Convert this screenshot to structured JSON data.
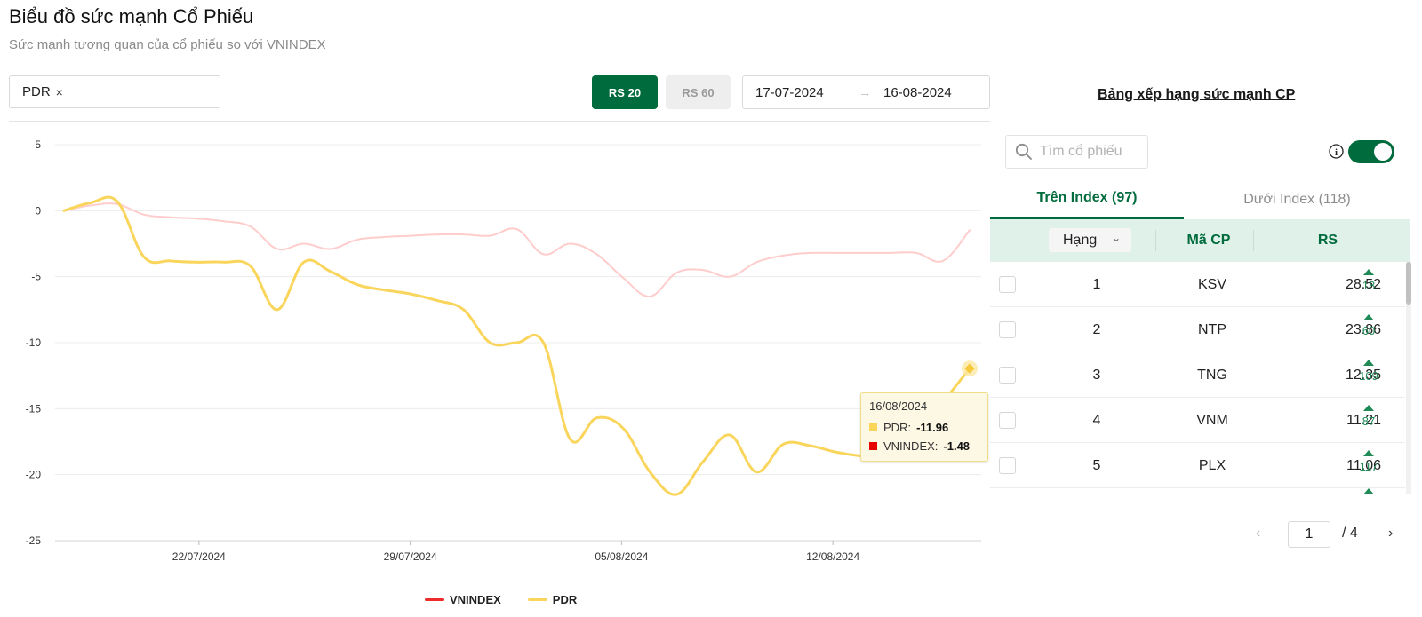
{
  "header": {
    "title": "Biểu đồ sức mạnh Cổ Phiếu",
    "subtitle": "Sức mạnh tương quan của cổ phiếu so với VNINDEX"
  },
  "filters": {
    "selected_stock": "PDR",
    "close_glyph": "×",
    "rs20_label": "RS 20",
    "rs60_label": "RS 60",
    "active_rs": "RS 20",
    "date_from": "17-07-2024",
    "date_arrow": "→",
    "date_to": "16-08-2024"
  },
  "chart_data": {
    "type": "line",
    "ylim": [
      -25,
      5
    ],
    "yticks": [
      "5",
      "0",
      "-5",
      "-10",
      "-15",
      "-20",
      "-25"
    ],
    "xticks": [
      "22/07/2024",
      "29/07/2024",
      "05/08/2024",
      "12/08/2024"
    ],
    "grid": true,
    "legend_position": "bottom",
    "series": [
      {
        "name": "VNINDEX",
        "color": "#ffcccc",
        "legend_color": "#ee2b2b",
        "values": [
          0,
          0.4,
          0.5,
          -0.3,
          -0.5,
          -0.6,
          -0.8,
          -1.2,
          -2.9,
          -2.5,
          -2.9,
          -2.2,
          -2.0,
          -1.9,
          -1.8,
          -1.8,
          -1.9,
          -1.4,
          -3.3,
          -2.5,
          -3.3,
          -5.1,
          -6.5,
          -4.7,
          -4.5,
          -5.0,
          -3.9,
          -3.4,
          -3.2,
          -3.2,
          -3.2,
          -3.2,
          -3.2,
          -3.8,
          -1.48
        ]
      },
      {
        "name": "PDR",
        "color": "#fad55c",
        "legend_color": "#fad55c",
        "values": [
          0,
          0.6,
          0.7,
          -3.5,
          -3.8,
          -3.9,
          -3.9,
          -4.2,
          -7.5,
          -3.9,
          -4.6,
          -5.6,
          -6.0,
          -6.3,
          -6.8,
          -7.5,
          -10.0,
          -10.0,
          -10.0,
          -17.3,
          -15.7,
          -16.5,
          -19.8,
          -21.5,
          -19.0,
          -17.0,
          -19.8,
          -17.7,
          -17.8,
          -18.3,
          -18.6,
          -18.7,
          -17.0,
          -14.5,
          -11.96
        ]
      }
    ],
    "tooltip": {
      "date": "16/08/2024",
      "rows": [
        {
          "name": "PDR:",
          "value": "-11.96",
          "color": "#fad55c"
        },
        {
          "name": "VNINDEX:",
          "value": "-1.48",
          "color": "#e60000"
        }
      ]
    }
  },
  "ranking": {
    "title": "Bảng xếp hạng sức mạnh CP",
    "search_placeholder": "Tìm cổ phiếu",
    "info_glyph": "i",
    "tabs": [
      {
        "label": "Trên Index (97)",
        "active": true
      },
      {
        "label": "Dưới Index (118)",
        "active": false
      }
    ],
    "columns": {
      "rank": "Hạng",
      "code": "Mã CP",
      "rs": "RS"
    },
    "sort_glyph": "⌄",
    "rows": [
      {
        "rank": "1",
        "code": "KSV",
        "rs": "28.52",
        "change": "18"
      },
      {
        "rank": "2",
        "code": "NTP",
        "rs": "23.86",
        "change": "60"
      },
      {
        "rank": "3",
        "code": "TNG",
        "rs": "12.35",
        "change": "109"
      },
      {
        "rank": "4",
        "code": "VNM",
        "rs": "11.21",
        "change": "87"
      },
      {
        "rank": "5",
        "code": "PLX",
        "rs": "11.06",
        "change": "117"
      }
    ],
    "pagination": {
      "prev_glyph": "‹",
      "current": "1",
      "total": "/  4",
      "next_glyph": "›"
    }
  }
}
